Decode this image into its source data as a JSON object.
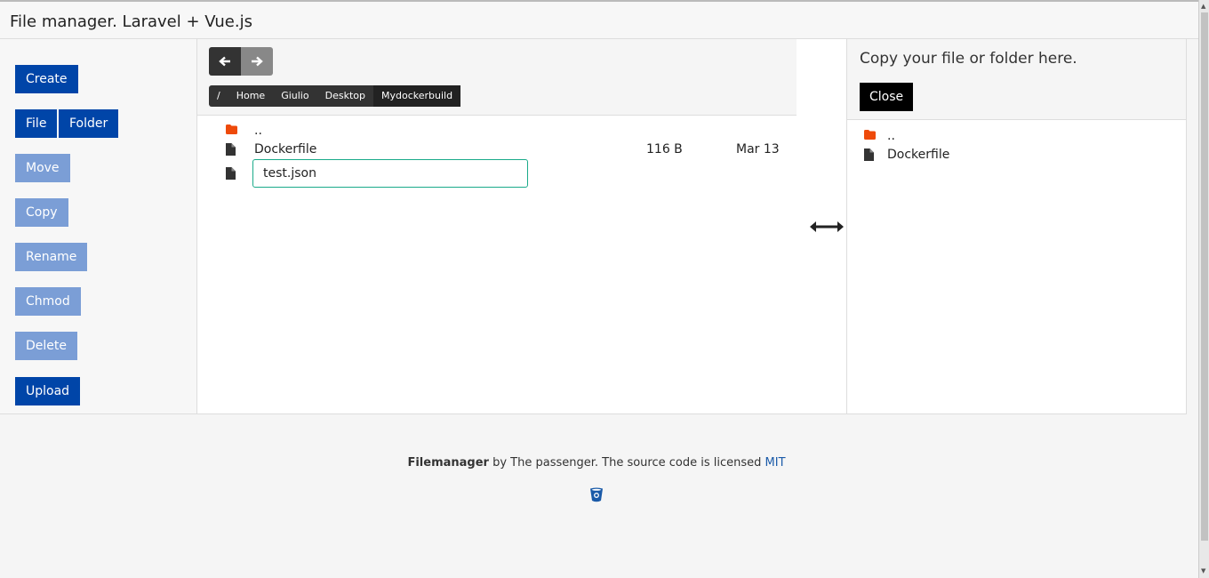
{
  "header": {
    "title": "File manager. Laravel + Vue.js"
  },
  "sidebar": {
    "create": "Create",
    "file": "File",
    "folder": "Folder",
    "move": "Move",
    "copy": "Copy",
    "rename": "Rename",
    "chmod": "Chmod",
    "delete": "Delete",
    "upload": "Upload"
  },
  "main": {
    "back_icon": "arrow-left-icon",
    "forward_icon": "arrow-right-icon",
    "breadcrumbs": [
      "/",
      "Home",
      "Giulio",
      "Desktop",
      "Mydockerbuild"
    ],
    "files": [
      {
        "name": "..",
        "type": "folder",
        "size": "",
        "date": ""
      },
      {
        "name": "Dockerfile",
        "type": "file",
        "size": "116 B",
        "date": "Mar 13"
      }
    ],
    "new_file": {
      "type": "file",
      "value": "test.json"
    }
  },
  "middle": {
    "icon": "swap-horizontal-icon"
  },
  "panel": {
    "title": "Copy your file or folder here.",
    "close": "Close",
    "files": [
      {
        "name": "..",
        "type": "folder"
      },
      {
        "name": "Dockerfile",
        "type": "file"
      }
    ]
  },
  "footer": {
    "brand": "Filemanager",
    "text": "by The passenger. The source code is licensed",
    "license": "MIT",
    "icon": "bitbucket-icon"
  },
  "colors": {
    "primary": "#0045a8",
    "disabled": "#7b9ed6",
    "folder": "#ee4a0a",
    "input_border": "#1aaa8a",
    "link": "#1a5aa8"
  }
}
